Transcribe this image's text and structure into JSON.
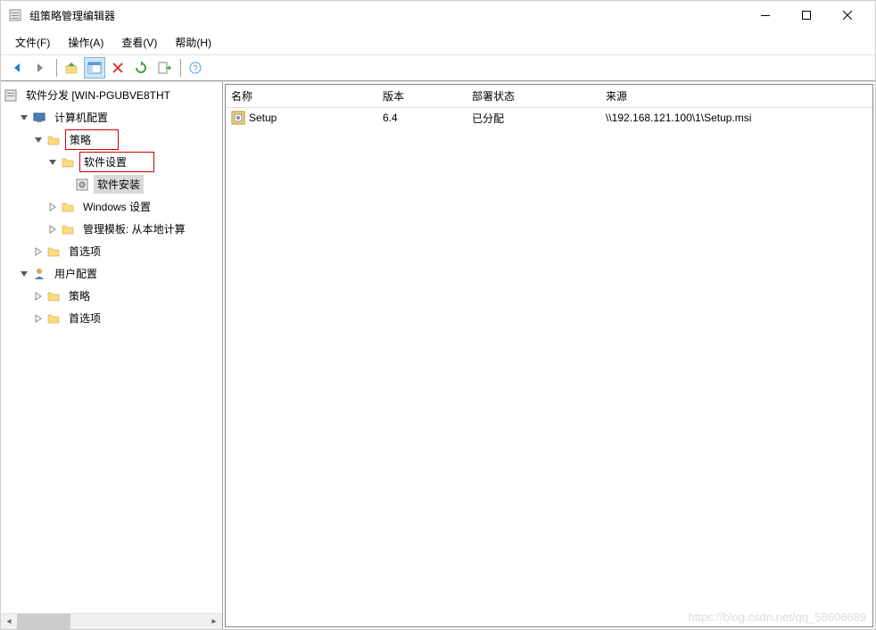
{
  "window": {
    "title": "组策略管理编辑器"
  },
  "menu": {
    "file": "文件(F)",
    "action": "操作(A)",
    "view": "查看(V)",
    "help": "帮助(H)"
  },
  "tree": {
    "root": "软件分发 [WIN-PGUBVE8THT",
    "computerConfig": "计算机配置",
    "policies": "策略",
    "softwareSettings": "软件设置",
    "softwareInstall": "软件安装",
    "windowsSettings": "Windows 设置",
    "adminTemplates": "管理模板: 从本地计算",
    "preferences": "首选项",
    "userConfig": "用户配置",
    "policies2": "策略",
    "preferences2": "首选项"
  },
  "columns": {
    "name": "名称",
    "version": "版本",
    "status": "部署状态",
    "source": "来源"
  },
  "rows": [
    {
      "name": "Setup",
      "version": "6.4",
      "status": "已分配",
      "source": "\\\\192.168.121.100\\1\\Setup.msi"
    }
  ],
  "watermark": "https://blog.csdn.net/qq_58606689"
}
